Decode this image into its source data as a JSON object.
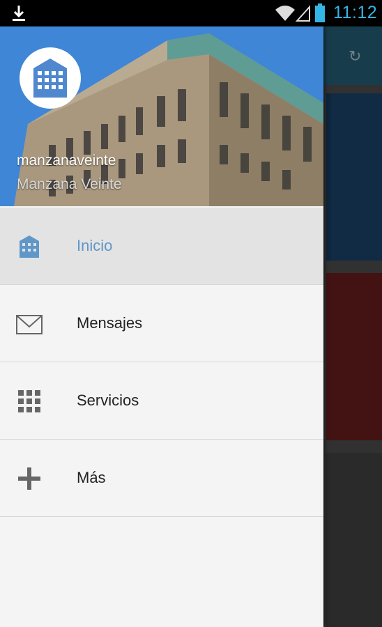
{
  "status_bar": {
    "time": "11:12"
  },
  "drawer": {
    "header": {
      "username": "manzanaveinte",
      "display_name": "Manzana Veinte"
    },
    "items": [
      {
        "label": "Inicio",
        "icon": "building-icon",
        "active": true
      },
      {
        "label": "Mensajes",
        "icon": "envelope-icon",
        "active": false
      },
      {
        "label": "Servicios",
        "icon": "grid-icon",
        "active": false
      },
      {
        "label": "Más",
        "icon": "plus-icon",
        "active": false
      }
    ]
  },
  "colors": {
    "status_accent": "#33b5e5",
    "active_label": "#5f97c9",
    "tile_blue": "#1f4f7e",
    "tile_red": "#7a2222"
  }
}
